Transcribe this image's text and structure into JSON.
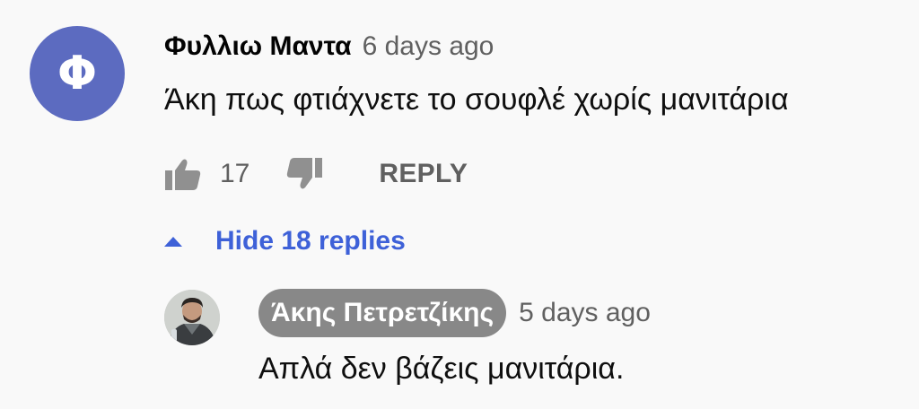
{
  "comment": {
    "avatar_letter": "Φ",
    "avatar_color": "#5c6bc0",
    "author": "Φυλλιω Μαντα",
    "time": "6 days ago",
    "text": "Άκη πως φτιάχνετε το σουφλέ χωρίς μανιτάρια",
    "like_count": "17",
    "reply_label": "REPLY",
    "like_icon": "thumbs-up-icon",
    "dislike_icon": "thumbs-down-icon"
  },
  "replies_toggle": {
    "label": "Hide 18 replies",
    "icon": "caret-up-icon",
    "color": "#3e61d8"
  },
  "reply": {
    "author": "Άκης Πετρετζίκης",
    "time": "5 days ago",
    "text": "Απλά δεν βάζεις μανιτάρια.",
    "avatar": "profile-photo"
  }
}
